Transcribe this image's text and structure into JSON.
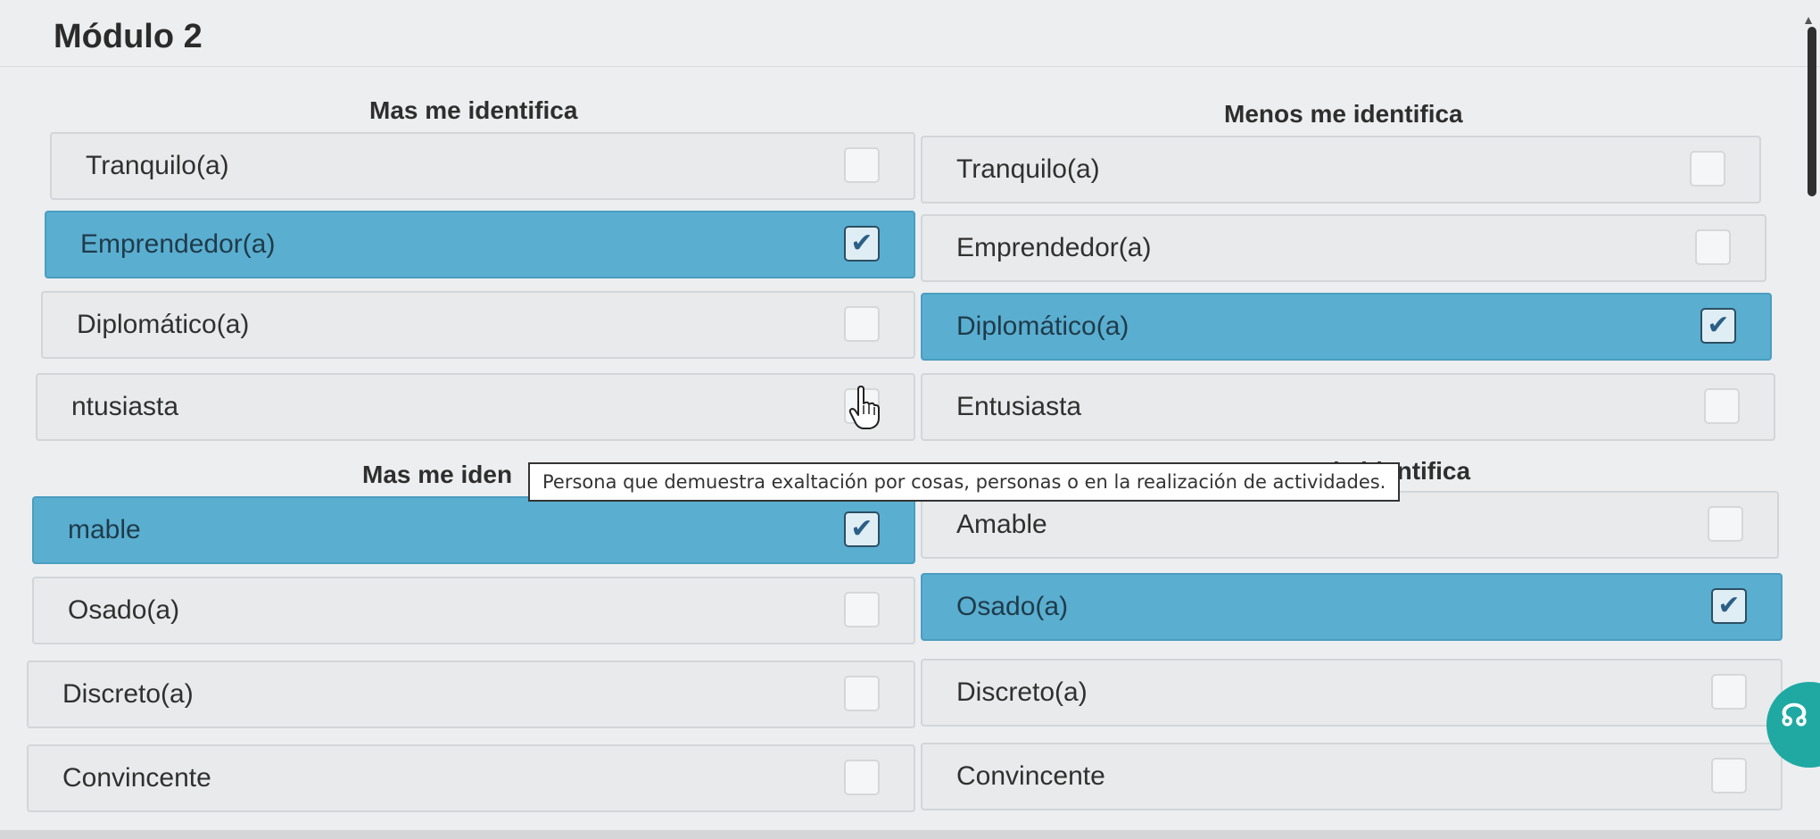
{
  "module_title": "Módulo 2",
  "groups": [
    {
      "header_left": "Mas me identifica",
      "header_right": "Menos me identifica",
      "rows": [
        {
          "left": {
            "label": "Tranquilo(a)",
            "checked": false
          },
          "right": {
            "label": "Tranquilo(a)",
            "checked": false
          }
        },
        {
          "left": {
            "label": "Emprendedor(a)",
            "checked": true
          },
          "right": {
            "label": "Emprendedor(a)",
            "checked": false
          }
        },
        {
          "left": {
            "label": "Diplomático(a)",
            "checked": false
          },
          "right": {
            "label": "Diplomático(a)",
            "checked": true
          }
        },
        {
          "left": {
            "label": "ntusiasta",
            "checked": false
          },
          "right": {
            "label": "Entusiasta",
            "checked": false
          }
        }
      ]
    },
    {
      "header_left": "Mas me iden",
      "header_right": "ie identifica",
      "rows": [
        {
          "left": {
            "label": "mable",
            "checked": true
          },
          "right": {
            "label": "Amable",
            "checked": false
          }
        },
        {
          "left": {
            "label": "Osado(a)",
            "checked": false
          },
          "right": {
            "label": "Osado(a)",
            "checked": true
          }
        },
        {
          "left": {
            "label": "Discreto(a)",
            "checked": false
          },
          "right": {
            "label": "Discreto(a)",
            "checked": false
          }
        },
        {
          "left": {
            "label": "Convincente",
            "checked": false
          },
          "right": {
            "label": "Convincente",
            "checked": false
          }
        }
      ]
    }
  ],
  "tooltip": "Persona que demuestra exaltación por cosas, personas o en la realización de actividades.",
  "check_glyph": "✔",
  "help_glyph": "☊",
  "icons": {
    "checkbox_checked": "check-icon",
    "cursor": "hand-cursor-icon",
    "help": "headset-icon",
    "scroll": "chevron-up-icon"
  },
  "colors": {
    "selected_fill": "#5aaed0",
    "option_fill": "#e8eaec",
    "help_fill": "#20a9a3"
  }
}
